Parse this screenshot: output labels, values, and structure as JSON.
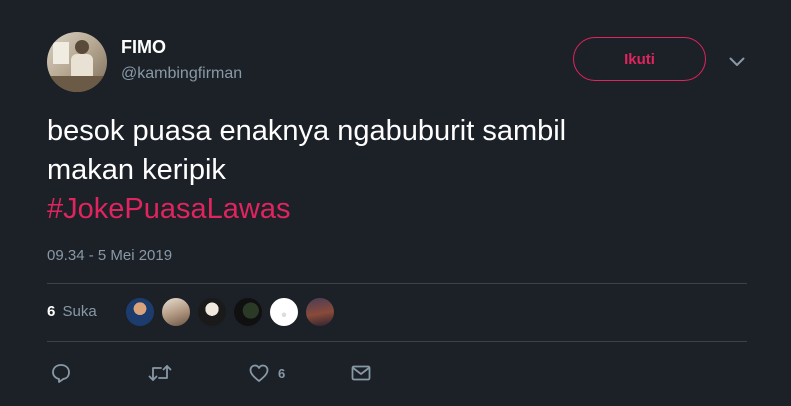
{
  "author": {
    "name": "FIMO",
    "handle": "@kambingfirman"
  },
  "follow_button": {
    "label": "Ikuti"
  },
  "tweet": {
    "text_line1": "besok puasa enaknya ngabuburit sambil",
    "text_line2": "makan keripik",
    "hashtag": "#JokePuasaLawas",
    "timestamp": "09.34 - 5 Mei 2019"
  },
  "stats": {
    "likes_count": "6",
    "likes_label": "Suka"
  },
  "actions": {
    "like_count": "6"
  },
  "colors": {
    "background": "#1c2027",
    "accent": "#e0245e",
    "secondary_text": "#8899a6",
    "divider": "#38444d"
  },
  "icons": [
    "chevron-down-icon",
    "reply-icon",
    "retweet-icon",
    "heart-icon",
    "envelope-icon"
  ]
}
